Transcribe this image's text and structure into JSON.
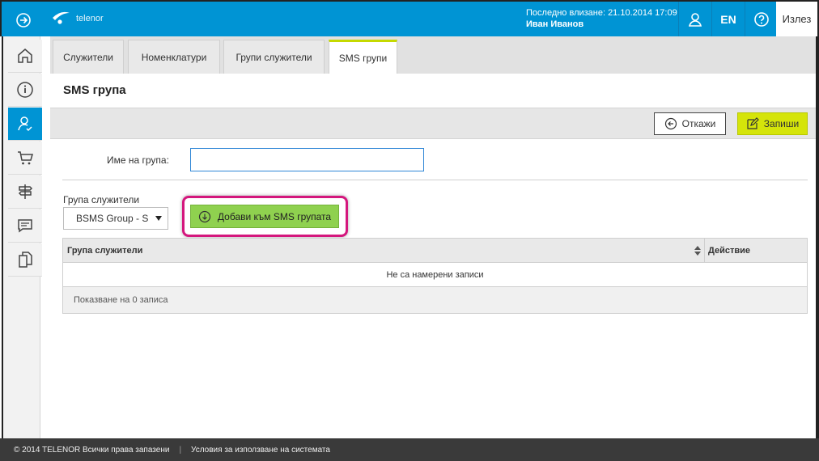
{
  "header": {
    "brand": "telenor",
    "last_login_label": "Последно влизане:",
    "last_login_value": "21.10.2014 17:09",
    "user_name": "Иван Иванов",
    "lang": "EN",
    "logout": "Излез",
    "accent": "#0094d4"
  },
  "sidebar": {
    "items": [
      {
        "name": "home-icon"
      },
      {
        "name": "info-icon"
      },
      {
        "name": "user-check-icon",
        "active": true
      },
      {
        "name": "cart-icon"
      },
      {
        "name": "signpost-icon"
      },
      {
        "name": "message-icon"
      },
      {
        "name": "documents-icon"
      }
    ]
  },
  "tabs": [
    {
      "label": "Служители"
    },
    {
      "label": "Номенклатури"
    },
    {
      "label": "Групи служители"
    },
    {
      "label": "SMS групи",
      "active": true
    }
  ],
  "page": {
    "title": "SMS група",
    "cancel_label": "Откажи",
    "save_label": "Запиши",
    "name_label": "Име на група:",
    "name_value": "",
    "group_label": "Група служители",
    "group_selected": "BSMS Group - S",
    "add_label": "Добави към SMS групата",
    "table": {
      "col1": "Група служители",
      "col2": "Действие",
      "empty": "Не са намерени записи",
      "footer": "Показване на 0 записа"
    }
  },
  "footer": {
    "copyright": "© 2014 TELENOR Всички права запазени",
    "terms": "Условия за използване на системата"
  }
}
